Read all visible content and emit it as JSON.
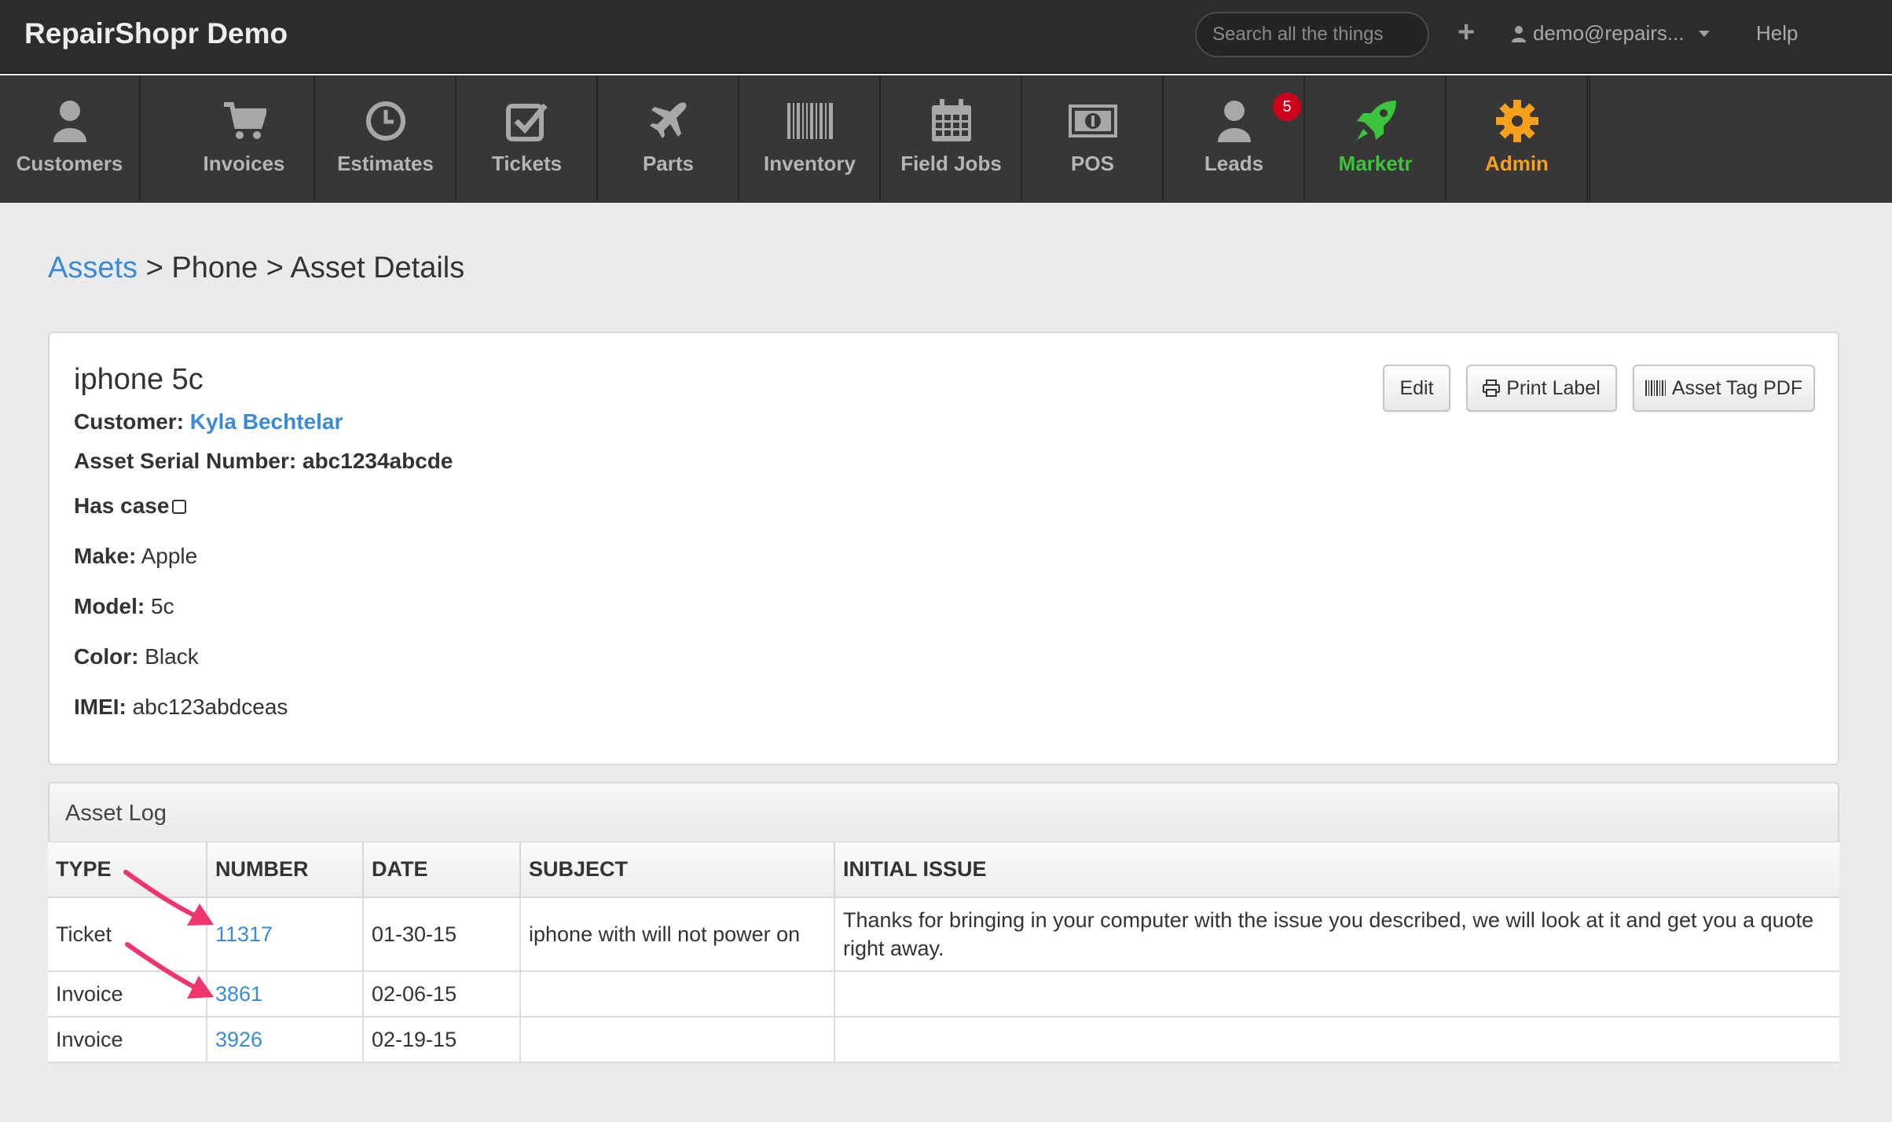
{
  "header": {
    "brand": "RepairShopr Demo",
    "search_placeholder": "Search all the things",
    "add_symbol": "+",
    "user_email": "demo@repairs...",
    "help_label": "Help"
  },
  "nav": {
    "items": [
      {
        "label": "Customers",
        "icon": "user-icon"
      },
      {
        "label": "Invoices",
        "icon": "cart-icon"
      },
      {
        "label": "Estimates",
        "icon": "clock-icon"
      },
      {
        "label": "Tickets",
        "icon": "check-square-icon"
      },
      {
        "label": "Parts",
        "icon": "plane-icon"
      },
      {
        "label": "Inventory",
        "icon": "barcode-icon"
      },
      {
        "label": "Field Jobs",
        "icon": "calendar-icon"
      },
      {
        "label": "POS",
        "icon": "money-icon"
      },
      {
        "label": "Leads",
        "icon": "user-icon"
      },
      {
        "label": "Marketr",
        "icon": "rocket-icon"
      },
      {
        "label": "Admin",
        "icon": "gear-icon"
      }
    ],
    "leads_badge": "5",
    "colors": {
      "default": "#b5b5b5",
      "marketr": "#3cc43c",
      "admin": "#f7a01b"
    }
  },
  "breadcrumb": {
    "root": "Assets",
    "sep1": " > ",
    "middle": "Phone",
    "sep2": " > ",
    "current": "Asset Details"
  },
  "asset": {
    "title": "iphone 5c",
    "customer_label": "Customer:",
    "customer_name": "Kyla Bechtelar",
    "serial_label": "Asset Serial Number:",
    "serial_value": "abc1234abcde",
    "has_case_label": "Has case",
    "make_label": "Make:",
    "make_value": "Apple",
    "model_label": "Model:",
    "model_value": "5c",
    "color_label": "Color:",
    "color_value": "Black",
    "imei_label": "IMEI:",
    "imei_value": "abc123abdceas"
  },
  "buttons": {
    "edit": "Edit",
    "print_label": "Print Label",
    "asset_tag_pdf": "Asset Tag PDF"
  },
  "asset_log": {
    "title": "Asset Log",
    "columns": [
      "TYPE",
      "NUMBER",
      "DATE",
      "SUBJECT",
      "INITIAL ISSUE"
    ],
    "rows": [
      {
        "type": "Ticket",
        "number": "11317",
        "date": "01-30-15",
        "subject": "iphone with will not power on",
        "issue": "Thanks for bringing in your computer with the issue you described, we will look at it and get you a quote right away."
      },
      {
        "type": "Invoice",
        "number": "3861",
        "date": "02-06-15",
        "subject": "",
        "issue": ""
      },
      {
        "type": "Invoice",
        "number": "3926",
        "date": "02-19-15",
        "subject": "",
        "issue": ""
      }
    ]
  }
}
